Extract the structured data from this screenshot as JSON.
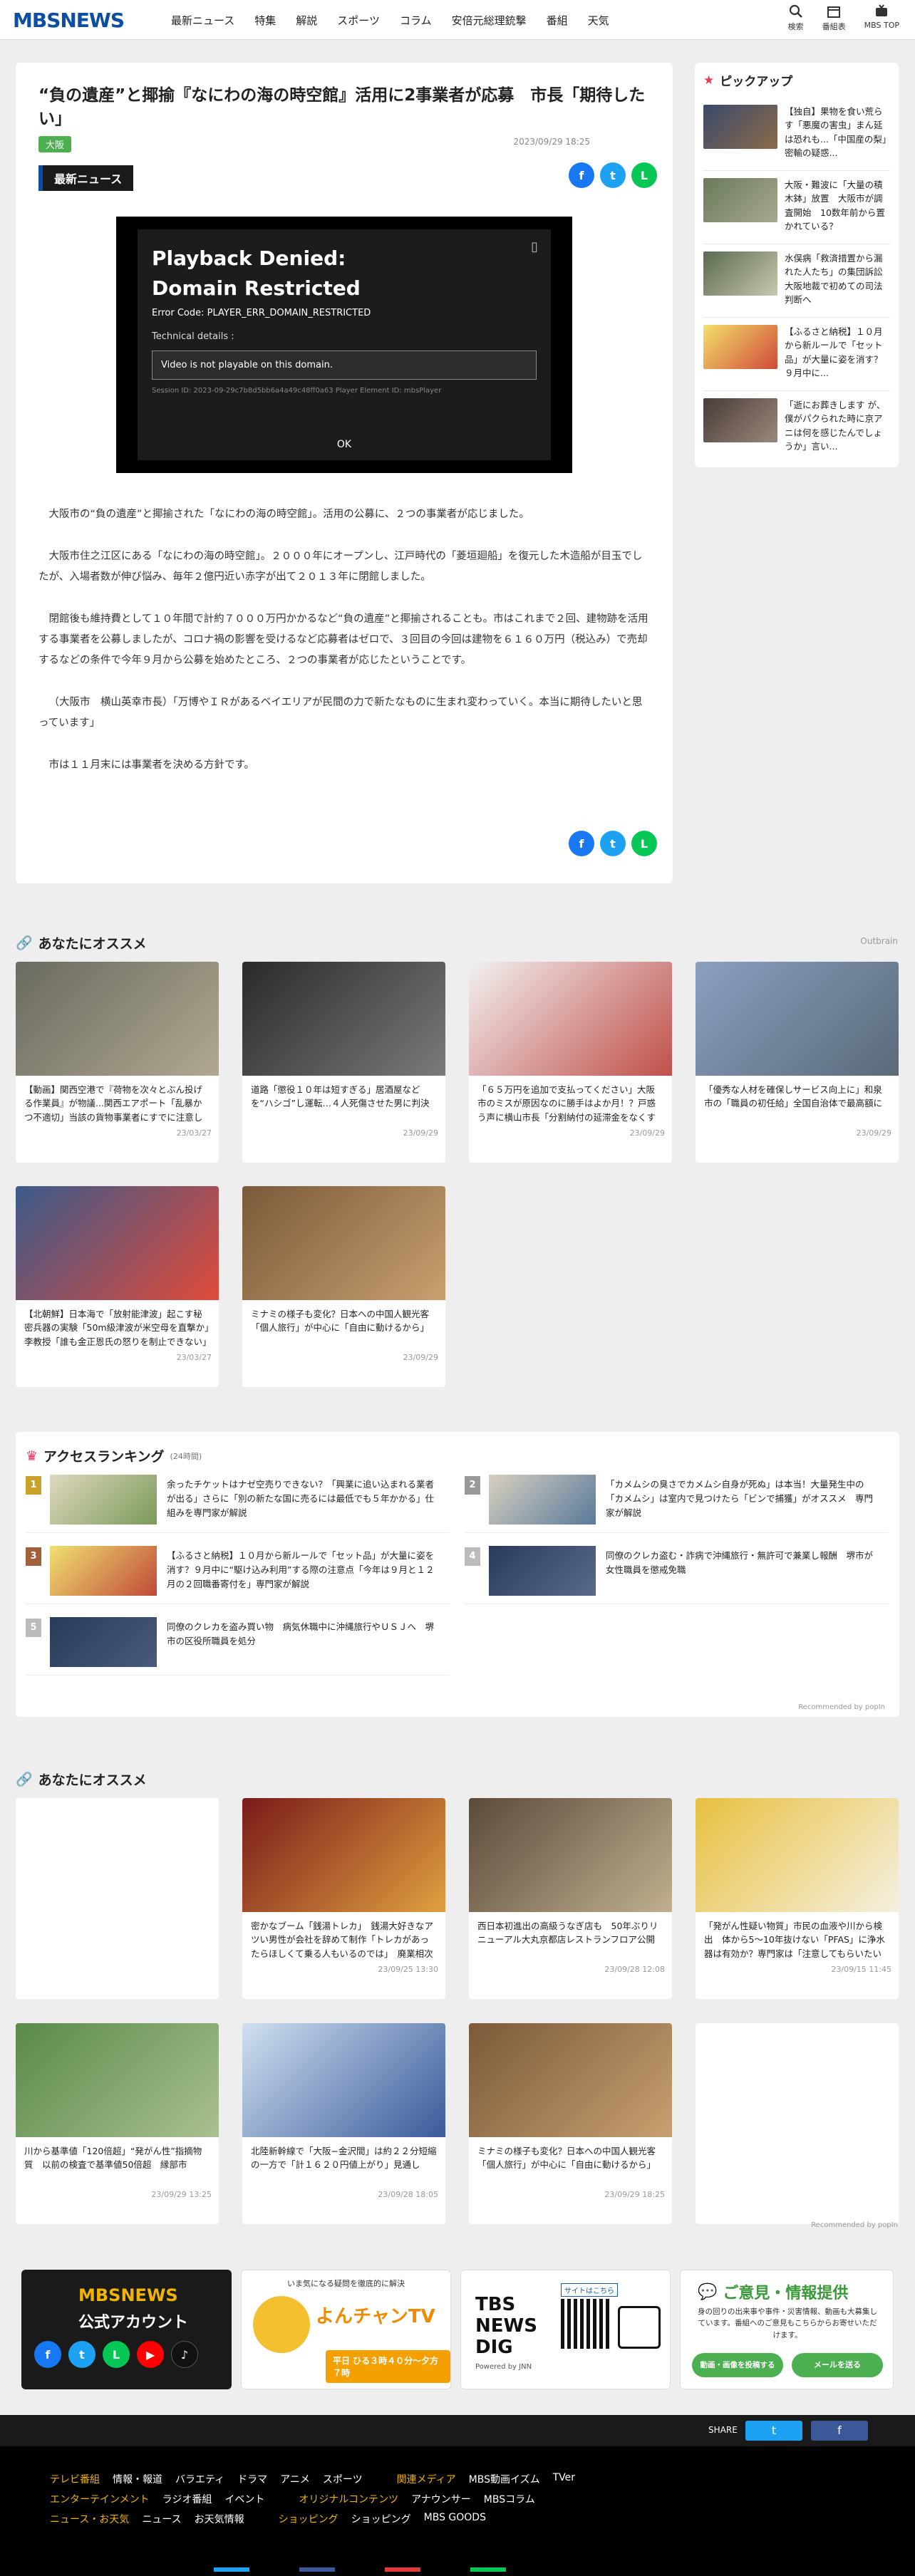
{
  "header": {
    "logo": "MBSNEWS",
    "nav": [
      "最新ニュース",
      "特集",
      "解説",
      "スポーツ",
      "コラム",
      "安倍元総理銃撃",
      "番組",
      "天気"
    ],
    "right": [
      "検索",
      "番組表",
      "MBS TOP"
    ]
  },
  "article": {
    "title": "“負の遺産”と揶揄『なにわの海の時空館』活用に2事業者が応募　市長「期待したい」",
    "tag": "大阪",
    "date": "2023/09/29 18:25",
    "category": "最新ニュース",
    "player": {
      "title": "Playback Denied: Domain Restricted",
      "error": "Error Code: PLAYER_ERR_DOMAIN_RESTRICTED",
      "details_label": "Technical details :",
      "message": "Video is not playable on this domain.",
      "session": "Session ID: 2023-09-29c7b8d5bb6a4a49c48ff0a63 Player Element ID: mbsPlayer",
      "ok": "OK"
    },
    "paragraphs": [
      "大阪市の“負の遺産”と揶揄された「なにわの海の時空館」。活用の公募に、２つの事業者が応じました。",
      "大阪市住之江区にある「なにわの海の時空館」。２０００年にオープンし、江戸時代の「菱垣廻船」を復元した木造船が目玉でしたが、入場者数が伸び悩み、毎年２億円近い赤字が出て２０１３年に閉館しました。",
      "閉館後も維持費として１０年間で計約７０００万円かかるなど“負の遺産”と揶揄されることも。市はこれまで２回、建物跡を活用する事業者を公募しましたが、コロナ禍の影響を受けるなど応募者はゼロで、３回目の今回は建物を６１６０万円（税込み）で売却するなどの条件で今年９月から公募を始めたところ、２つの事業者が応じたということです。",
      "（大阪市　横山英幸市長）「万博やＩＲがあるベイエリアが民間の力で新たなものに生まれ変わっていく。本当に期待したいと思っています」",
      "市は１１月末には事業者を決める方針です。"
    ]
  },
  "pickup": {
    "title": "ピックアップ",
    "items": [
      "【独自】果物を食い荒らす「悪魔の害虫」まん延は恐れも...「中国産の梨」密輸の疑惑...",
      "大阪・難波に「大量の積木鉢」放置　大阪市が調査開始　10数年前から置かれている？",
      "水俣病「救済措置から漏れた人たち」の集団訴訟　大阪地裁で初めての司法判断へ",
      "【ふるさと納税】１０月から新ルールで「セット品」が大量に姿を消す？９月中に...",
      "「逝にお葬きします が、僕がパクられた時に京アニは何を感じたんでしょうか」言い..."
    ]
  },
  "rec1": {
    "title": "あなたにオススメ",
    "brand": "Outbrain",
    "cards": [
      {
        "text": "【動画】関西空港で『荷物を次々とぶん投げる作業員』が物議...関西エアポート「乱暴かつ不適切」当該の貨物事業者にすでに注意した」",
        "date": "23/03/27"
      },
      {
        "text": "道路「懲役１０年は短すぎる」居酒屋などを“ハシゴ”し運転…４人死傷させた男に判決",
        "date": "23/09/29"
      },
      {
        "text": "「６５万円を追加で支払ってください」大阪市のミスが原因なのに勝手はよか月！？戸惑う声に横山市長「分割納付の延滞金をなくすなど検討したい」　支...",
        "date": "23/09/29"
      },
      {
        "text": "「優秀な人材を確保しサービス向上に」和泉市の「職員の初任給」全国自治体で最高額に",
        "date": "23/09/29"
      },
      {
        "text": "【北朝鮮】日本海で「放射能津波」起こす秘密兵器の実験「50m級津波が米空母を直撃か」李教授「誰も金正恩氏の怒りを制止できない」",
        "date": "23/03/27"
      },
      {
        "text": "ミナミの様子も変化？日本への中国人観光客「個人旅行」が中心に「自由に動けるから」",
        "date": "23/09/29"
      }
    ]
  },
  "ranking": {
    "title": "アクセスランキング",
    "count": "(24時間)",
    "items": [
      "余ったチケットはナゼ空売りできない？「興業に追い込まれる業者が出る」さらに「別の新たな国に売るには最低でも５年かかる」仕組みを専門家が解説",
      "「カメムシの臭さでカメムシ自身が死ぬ」は本当！大量発生中の「カメムシ」は室内で見つけたら「ビンで捕獲」がオススメ　専門家が解説",
      "【ふるさと納税】１０月から新ルールで「セット品」が大量に姿を消す？９月中に“駆け込み利用”する際の注意点「今年は９月と１２月の２回職番寄付を」専門家が解説",
      "同僚のクレカ盗む・詐病で沖縄旅行・無許可で兼業し報酬　堺市が女性職員を懲戒免職",
      "同僚のクレカを盗み買い物　病気休職中に沖縄旅行やＵＳＪへ　堺市の区役所職員を処分"
    ],
    "recommended": "Recommended by popIn"
  },
  "rec2": {
    "title": "あなたにオススメ",
    "cards": [
      {
        "text": "",
        "date": ""
      },
      {
        "text": "密かなブーム「銭湯トレカ」　銭湯大好きなアツい男性が会社を辞めて制作「トレカがあったらほしくて乗る人もいるのでは」　廃業相次ぐこの業界...",
        "date": "23/09/25 13:30"
      },
      {
        "text": "西日本初進出の高級うなぎ店も　50年ぶりリニューアル大丸京都店レストランフロア公開",
        "date": "23/09/28 12:08"
      },
      {
        "text": "「発がん性疑い物質」市民の血液や川から検出　体から5～10年抜けない「PFAS」に浄水器は有効か？専門家は「注意してもらいたいのは交換時期...",
        "date": "23/09/15 11:45"
      },
      {
        "text": "川から基準値「120倍超」“発がん性”指摘物質　以前の検査で基準値50倍超　縁部市",
        "date": "23/09/29 13:25"
      },
      {
        "text": "北陸新幹線で「大阪−金沢間」は約２２分短縮の一方で「計１６２０円値上がり」見通し",
        "date": "23/09/28 18:05"
      },
      {
        "text": "ミナミの様子も変化？日本への中国人観光客「個人旅行」が中心に「自由に動けるから」",
        "date": "23/09/29 18:25"
      },
      {
        "text": "",
        "date": ""
      }
    ],
    "recommended": "Recommended by popIn"
  },
  "banners": {
    "mbs": {
      "logo": "MBSNEWS",
      "line": "公式アカウント"
    },
    "yonchan": {
      "top": "いま気になる疑問を徹底的に解決",
      "name": "よんチャンTV",
      "sub": "平日 ひる３時４０分〜夕方７時"
    },
    "tbs": {
      "name": "TBS NEWS DIG",
      "powered": "Powered by JNN",
      "qr": "サイトはこちら"
    },
    "opinion": {
      "title": "ご意見・情報提供",
      "text": "身の回りの出来事や事件・災害情報、動画も大募集しています。番組へのご意見もこちらからお寄せいただけます。",
      "btn1": "動画・画像を投稿する",
      "btn2": "メールを送る"
    }
  },
  "footer": {
    "share": "SHARE",
    "rows": [
      [
        "テレビ番組",
        "情報・報道",
        "バラエティ",
        "ドラマ",
        "アニメ",
        "スポーツ",
        "関連メディア",
        "MBS動画イズム",
        "TVer"
      ],
      [
        "エンターテインメント",
        "ラジオ番組",
        "イベント",
        "オリジナルコンテンツ",
        "アナウンサー",
        "MBSコラム"
      ],
      [
        "ニュース・お天気",
        "ニュース",
        "お天気情報",
        "ショッピング",
        "ショッピング",
        "MBS GOODS"
      ]
    ]
  }
}
